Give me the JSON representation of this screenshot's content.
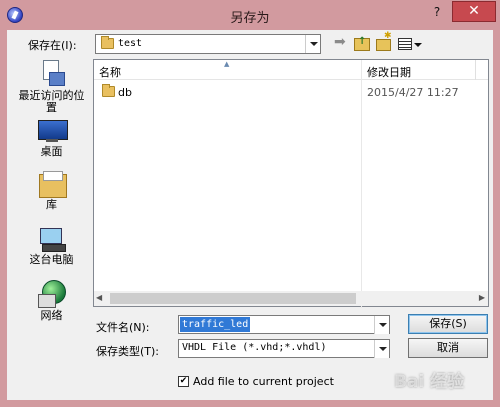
{
  "window": {
    "title": "另存为",
    "help_label": "?",
    "close_label": "✕"
  },
  "lookin": {
    "label": "保存在(I):",
    "value": "test"
  },
  "places": [
    {
      "label": "最近访问的位置",
      "icon": "recent-places-icon"
    },
    {
      "label": "桌面",
      "icon": "desktop-icon"
    },
    {
      "label": "库",
      "icon": "libraries-icon"
    },
    {
      "label": "这台电脑",
      "icon": "computer-icon"
    },
    {
      "label": "网络",
      "icon": "network-icon"
    }
  ],
  "filelist": {
    "columns": {
      "name": "名称",
      "date": "修改日期"
    },
    "rows": [
      {
        "name": "db",
        "date": "2015/4/27 11:27"
      }
    ]
  },
  "form": {
    "filename_label": "文件名(N):",
    "filename_value": "traffic_led",
    "filetype_label": "保存类型(T):",
    "filetype_value": "VHDL File (*.vhd;*.vhdl)",
    "save_label": "保存(S)",
    "cancel_label": "取消",
    "checkbox_label": "Add file to current project",
    "checkbox_checked": true
  },
  "watermark": "Bai 经验"
}
